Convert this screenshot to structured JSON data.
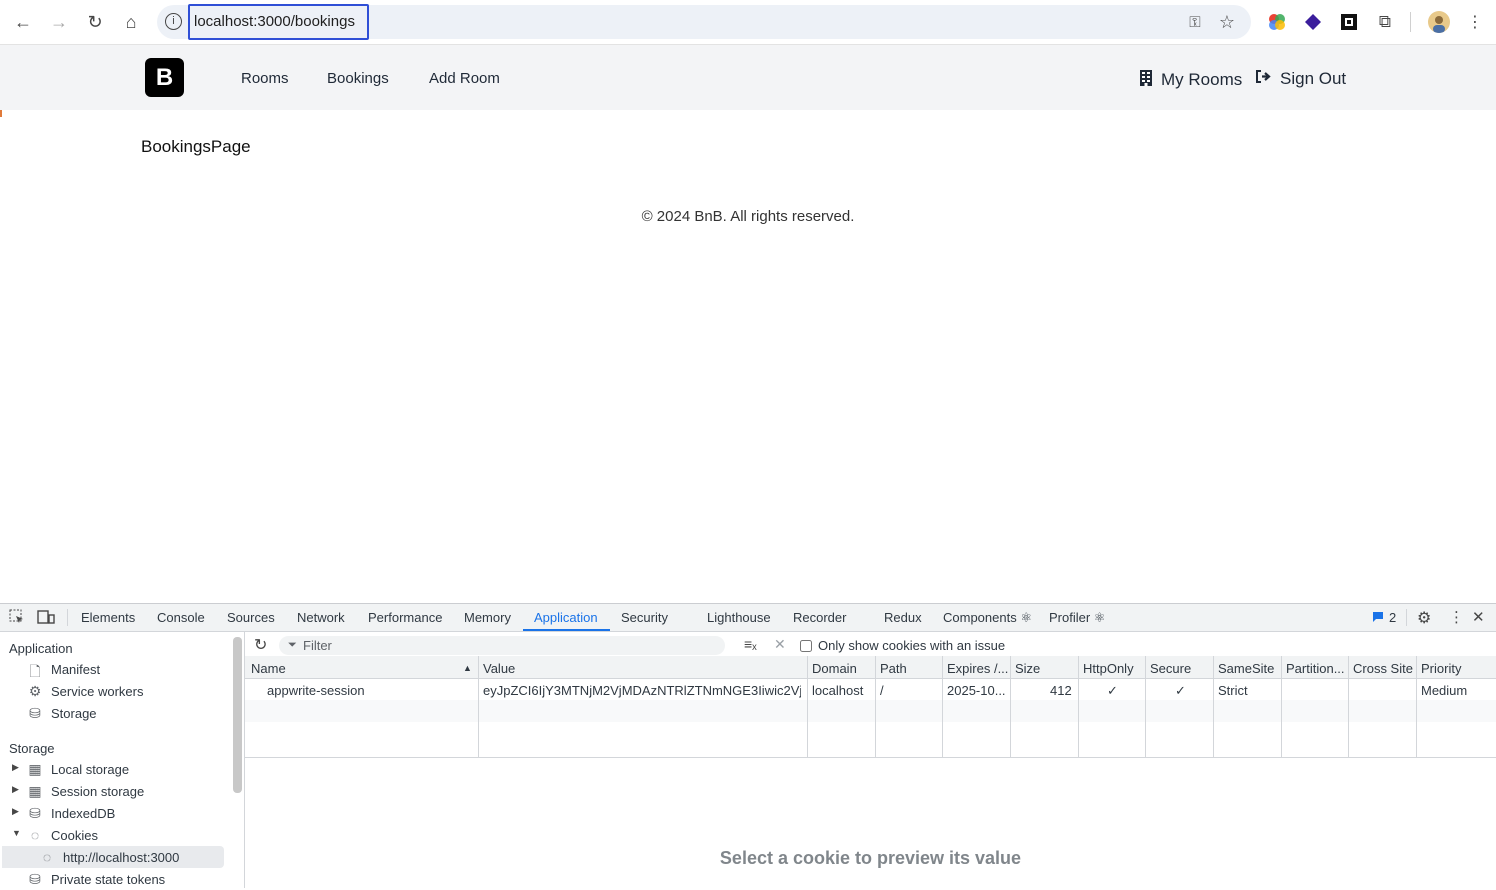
{
  "browser": {
    "url": "localhost:3000/bookings",
    "back_icon": "arrow-left",
    "forward_icon": "arrow-right",
    "reload_icon": "reload",
    "home_icon": "home",
    "site_info_icon": "info-circle",
    "password_icon": "key",
    "bookmark_icon": "star",
    "extensions_icon": "puzzle",
    "menu_icon": "kebab"
  },
  "app": {
    "logo_letter": "B",
    "nav": [
      "Rooms",
      "Bookings",
      "Add Room"
    ],
    "my_rooms": "My Rooms",
    "sign_out": "Sign Out",
    "heading": "BookingsPage",
    "footer": "© 2024 BnB. All rights reserved."
  },
  "devtools": {
    "tabs": [
      "Elements",
      "Console",
      "Sources",
      "Network",
      "Performance",
      "Memory",
      "Application",
      "Security",
      "Lighthouse",
      "Recorder",
      "Redux",
      "Components ⚛",
      "Profiler ⚛"
    ],
    "active_tab": "Application",
    "issues_count": "2",
    "sidebar": {
      "application_header": "Application",
      "application_items": [
        "Manifest",
        "Service workers",
        "Storage"
      ],
      "storage_header": "Storage",
      "storage_items": [
        "Local storage",
        "Session storage",
        "IndexedDB",
        "Cookies",
        "http://localhost:3000",
        "Private state tokens"
      ]
    },
    "toolbar": {
      "filter_placeholder": "Filter",
      "only_issue_label": "Only show cookies with an issue"
    },
    "table": {
      "columns": [
        "Name",
        "Value",
        "Domain",
        "Path",
        "Expires /...",
        "Size",
        "HttpOnly",
        "Secure",
        "SameSite",
        "Partition...",
        "Cross Site",
        "Priority"
      ],
      "rows": [
        [
          "appwrite-session",
          "eyJpZCI6IjY3MTNjM2VjMDAzNTRlZTNmNGE3Iiwic2Vj...",
          "localhost",
          "/",
          "2025-10...",
          "412",
          "✓",
          "✓",
          "Strict",
          "",
          "",
          "Medium"
        ]
      ]
    },
    "preview_message": "Select a cookie to preview its value"
  }
}
